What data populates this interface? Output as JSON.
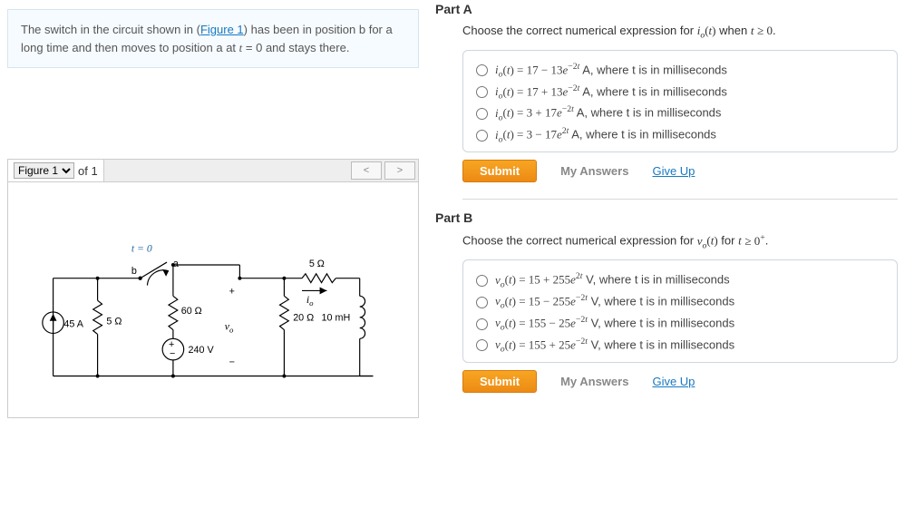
{
  "statement": {
    "pre": "The switch in the circuit shown in (",
    "link": "Figure 1",
    "post": ") has been in position b for a long time and then moves to position a at ",
    "tail": " = 0 and stays there."
  },
  "figure": {
    "label": "Figure 1",
    "of": "of 1",
    "prev": "<",
    "next": ">"
  },
  "circuit": {
    "t0": "t = 0",
    "node_b": "b",
    "node_a": "a",
    "r5": "5 Ω",
    "r60": "60 Ω",
    "r5b": "5 Ω",
    "r20": "20 Ω",
    "l": "10 mH",
    "vsrc": "240 V",
    "isrc": "45 A",
    "vo": "v",
    "vo_sub": "o",
    "io": "i",
    "io_sub": "o",
    "plus": "+",
    "minus": "−"
  },
  "partA": {
    "heading": "Part A",
    "prompt_pre": "Choose the correct numerical expression for ",
    "prompt_post": " when ",
    "options": [
      " A, where t is in milliseconds",
      " A, where t is in milliseconds",
      " A, where t is in milliseconds",
      " A, where t is in milliseconds"
    ],
    "math": [
      "i_o(t) = 17 − 13e^{-2t}",
      "i_o(t) = 17 + 13e^{-2t}",
      "i_o(t) = 3 + 17e^{-2t}",
      "i_o(t) = 3 − 17e^{2t}"
    ]
  },
  "partB": {
    "heading": "Part B",
    "prompt_pre": "Choose the correct numerical expression for ",
    "prompt_post": " for ",
    "options": [
      " V, where t is in milliseconds",
      " V, where t is in milliseconds",
      " V, where t is in milliseconds",
      " V, where t is in milliseconds"
    ],
    "math": [
      "v_o(t) = 15 + 255e^{2t}",
      "v_o(t) = 15 − 255e^{-2t}",
      "v_o(t) = 155 − 25e^{-2t}",
      "v_o(t) = 155 + 25e^{-2t}"
    ]
  },
  "ui": {
    "submit": "Submit",
    "my_answers": "My Answers",
    "give_up": "Give Up"
  }
}
